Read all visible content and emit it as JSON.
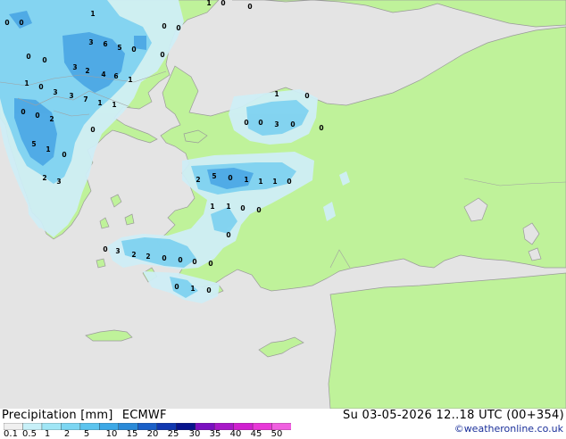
{
  "footer": {
    "title_left": "Precipitation [mm]",
    "title_model": "ECMWF",
    "datetime": "Su 03-05-2026 12..18 UTC (00+354)",
    "credit": "©weatheronline.co.uk"
  },
  "legend": {
    "ticks": [
      "0.1",
      "0.5",
      "1",
      "2",
      "5",
      "10",
      "15",
      "20",
      "25",
      "30",
      "35",
      "40",
      "45",
      "50"
    ],
    "colors": [
      "#f0f0f0",
      "#c8f0f8",
      "#a0e6f6",
      "#7cd6f2",
      "#5cc4ee",
      "#3ca8e6",
      "#2a8ad8",
      "#1a60c8",
      "#1038b0",
      "#08148c",
      "#7a10c0",
      "#a818c8",
      "#d020d0",
      "#e838d8",
      "#f060e0"
    ]
  },
  "colors": {
    "land": "#bff29a",
    "sea": "#e4e4e4",
    "precip_light": "#cfeef6",
    "precip_med": "#7fd2f0",
    "precip_heavy": "#4aa6e4",
    "border": "#909090"
  },
  "grid_values": [
    "1",
    "0",
    "0",
    "0",
    "0",
    "1",
    "0",
    "0",
    "3",
    "6",
    "5",
    "0",
    "0",
    "0",
    "0",
    "3",
    "2",
    "4",
    "6",
    "1",
    "1",
    "0",
    "3",
    "3",
    "7",
    "1",
    "1",
    "0",
    "0",
    "2",
    "1",
    "0",
    "0",
    "0",
    "3",
    "0",
    "0",
    "5",
    "1",
    "0",
    "0",
    "2",
    "5",
    "0",
    "1",
    "1",
    "1",
    "0",
    "1",
    "1",
    "0",
    "0",
    "2",
    "3",
    "0",
    "3",
    "2",
    "2",
    "0",
    "0",
    "0",
    "0",
    "0",
    "1",
    "0",
    "0"
  ]
}
